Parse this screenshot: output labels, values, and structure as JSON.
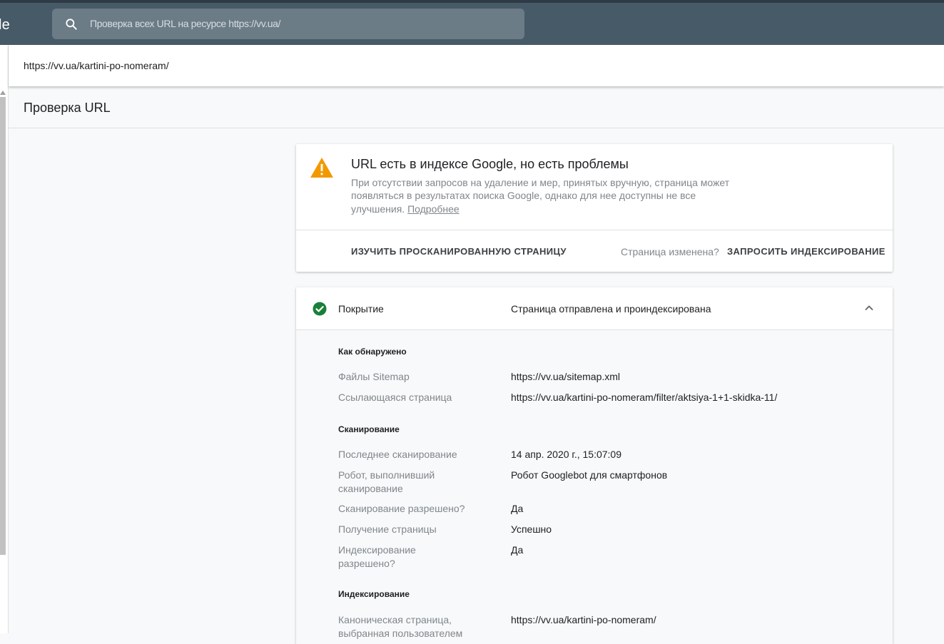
{
  "header": {
    "logo_fragment": "le",
    "search_placeholder": "Проверка всех URL на ресурсе https://vv.ua/"
  },
  "url_bar": {
    "url": "https://vv.ua/kartini-po-nomeram/"
  },
  "page": {
    "title": "Проверка URL"
  },
  "status_card": {
    "title": "URL есть в индексе Google, но есть проблемы",
    "description": "При отсутствии запросов на удаление и мер, принятых вручную, страница может появляться в результатах поиска Google, однако для нее доступны не все улучшения.",
    "more_link": "Подробнее",
    "button_view_crawled": "ИЗУЧИТЬ ПРОСКАНИРОВАННУЮ СТРАНИЦУ",
    "page_changed": "Страница изменена?",
    "button_request_indexing": "ЗАПРОСИТЬ ИНДЕКСИРОВАНИЕ"
  },
  "coverage": {
    "label": "Покрытие",
    "value": "Страница отправлена и проиндексирована",
    "sections": {
      "discovery": {
        "title": "Как обнаружено",
        "rows": [
          {
            "key": "Файлы Sitemap",
            "value": "https://vv.ua/sitemap.xml"
          },
          {
            "key": "Ссылающаяся страница",
            "value": "https://vv.ua/kartini-po-nomeram/filter/aktsiya-1+1-skidka-11/"
          }
        ]
      },
      "crawl": {
        "title": "Сканирование",
        "rows": [
          {
            "key": "Последнее сканирование",
            "value": "14 апр. 2020 г., 15:07:09"
          },
          {
            "key": "Робот, выполнивший сканирование",
            "value": "Робот Googlebot для смартфонов"
          },
          {
            "key": "Сканирование разрешено?",
            "value": "Да"
          },
          {
            "key": "Получение страницы",
            "value": "Успешно"
          },
          {
            "key": "Индексирование разрешено?",
            "value": "Да"
          }
        ]
      },
      "indexing": {
        "title": "Индексирование",
        "rows": [
          {
            "key": "Каноническая страница, выбранная пользователем",
            "value": "https://vv.ua/kartini-po-nomeram/"
          }
        ]
      }
    }
  },
  "colors": {
    "header_bg": "#475a68",
    "warning": "#f29900",
    "success": "#188038"
  }
}
